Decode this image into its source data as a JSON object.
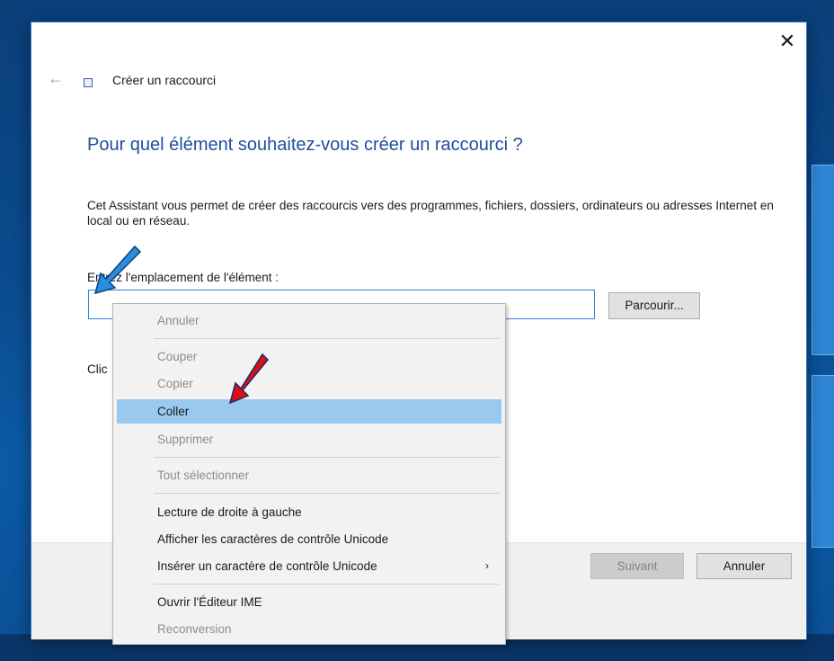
{
  "window": {
    "close_glyph": "✕",
    "back_glyph": "←",
    "wizard_title": "Créer un raccourci"
  },
  "content": {
    "heading": "Pour quel élément souhaitez-vous créer un raccourci ?",
    "description": "Cet Assistant vous permet de créer des raccourcis vers des programmes, fichiers, dossiers, ordinateurs ou adresses Internet en local ou en réseau.",
    "field_label": "Entrez l'emplacement de l'élément :",
    "location_value": "",
    "browse_label": "Parcourir...",
    "partial_label": "Clic"
  },
  "footer": {
    "next_label": "Suivant",
    "cancel_label": "Annuler"
  },
  "context_menu": {
    "items": [
      {
        "label": "Annuler",
        "disabled": true
      },
      {
        "label": "Couper",
        "disabled": true
      },
      {
        "label": "Copier",
        "disabled": true
      },
      {
        "label": "Coller",
        "disabled": false,
        "highlighted": true
      },
      {
        "label": "Supprimer",
        "disabled": true
      },
      {
        "label": "Tout sélectionner",
        "disabled": true
      },
      {
        "label": "Lecture de droite à gauche",
        "disabled": false
      },
      {
        "label": "Afficher les caractères de contrôle Unicode",
        "disabled": false
      },
      {
        "label": "Insérer un caractère de contrôle Unicode",
        "disabled": false,
        "submenu_glyph": "›"
      },
      {
        "label": "Ouvrir l'Éditeur IME",
        "disabled": false
      },
      {
        "label": "Reconversion",
        "disabled": true
      }
    ]
  },
  "colors": {
    "heading_blue": "#1f4e9a",
    "highlight": "#99c9ef",
    "input_border": "#2f86d6",
    "annotation_blue": "#2b8de0",
    "annotation_red": "#e01010"
  },
  "icons": [
    "close-icon",
    "back-arrow-icon",
    "wizard-icon",
    "submenu-chevron-icon"
  ]
}
